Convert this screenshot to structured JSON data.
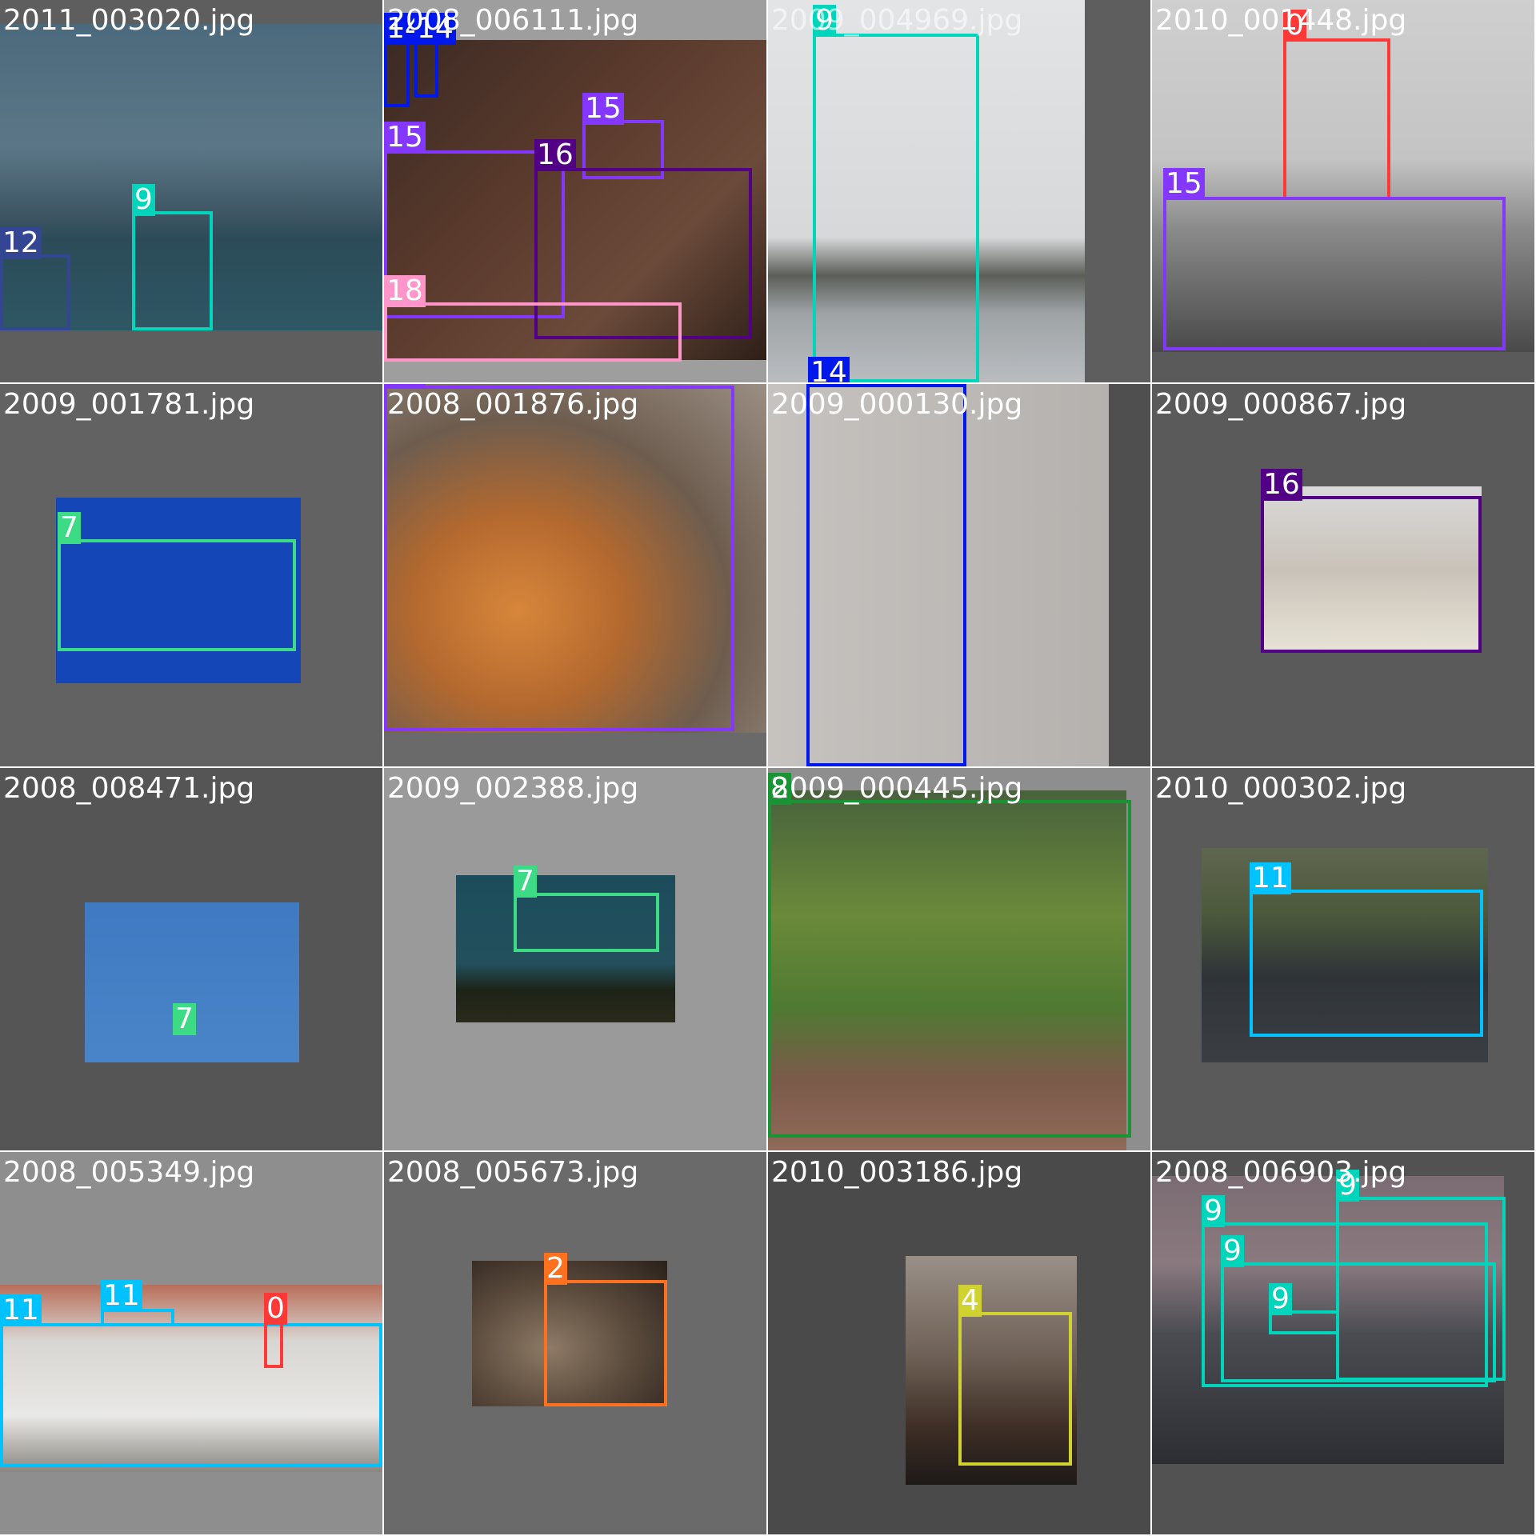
{
  "tiles": [
    {
      "file": "2011_003020.jpg",
      "labels": [
        "12",
        "9"
      ]
    },
    {
      "file": "2008_006111.jpg",
      "labels": [
        "14",
        "14",
        "15",
        "15",
        "16",
        "18"
      ]
    },
    {
      "file": "2009_004969.jpg",
      "labels": [
        "9",
        "14"
      ]
    },
    {
      "file": "2010_001448.jpg",
      "labels": [
        "0",
        "15"
      ]
    },
    {
      "file": "2009_001781.jpg",
      "labels": [
        "7"
      ]
    },
    {
      "file": "2008_001876.jpg",
      "labels": [
        "15"
      ]
    },
    {
      "file": "2009_000130.jpg",
      "labels": [
        "14"
      ]
    },
    {
      "file": "2009_000867.jpg",
      "labels": [
        "16"
      ]
    },
    {
      "file": "2008_008471.jpg",
      "labels": [
        "7"
      ]
    },
    {
      "file": "2009_002388.jpg",
      "labels": [
        "7"
      ]
    },
    {
      "file": "2009_000445.jpg",
      "labels": [
        "8"
      ]
    },
    {
      "file": "2010_000302.jpg",
      "labels": [
        "11"
      ]
    },
    {
      "file": "2008_005349.jpg",
      "labels": [
        "11",
        "11",
        "0"
      ]
    },
    {
      "file": "2008_005673.jpg",
      "labels": [
        "2"
      ]
    },
    {
      "file": "2010_003186.jpg",
      "labels": [
        "4"
      ]
    },
    {
      "file": "2008_006903.jpg",
      "labels": [
        "9",
        "9",
        "9",
        "9"
      ]
    }
  ],
  "colors": {
    "0": "#ff3838",
    "2": "#ff701f",
    "4": "#cfd231",
    "7": "#3ddb86",
    "8": "#1a9334",
    "9": "#00d4bb",
    "11": "#00c2ff",
    "12": "#344593",
    "14": "#0018ec",
    "15": "#8438ff",
    "16": "#520085",
    "18": "#ff95c8"
  }
}
